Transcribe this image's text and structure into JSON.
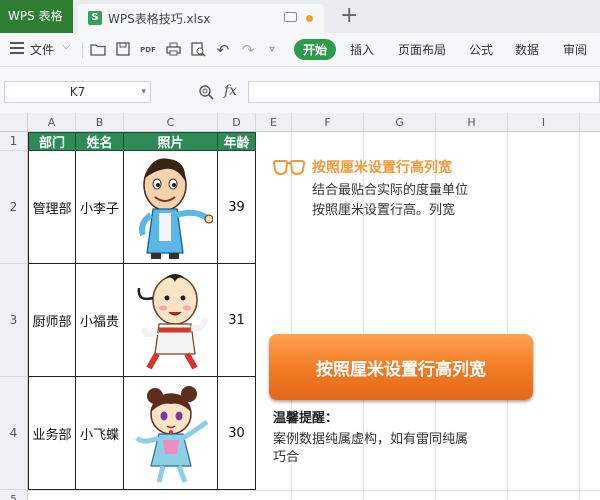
{
  "tabbar": {
    "app_tab": "WPS 表格",
    "doc_tab": "WPS表格技巧.xlsx",
    "new_tab": "+"
  },
  "ribbon": {
    "file_label": "文件",
    "tabs": [
      "开始",
      "插入",
      "页面布局",
      "公式",
      "数据",
      "审阅"
    ],
    "active_tab": "开始"
  },
  "formula_bar": {
    "name_box": "K7",
    "fx_label": "fx",
    "formula": ""
  },
  "grid": {
    "columns": [
      "A",
      "B",
      "C",
      "D",
      "E",
      "F",
      "G",
      "H",
      "I"
    ],
    "rows": [
      "1",
      "2",
      "3",
      "4",
      "5"
    ],
    "headers": [
      "部门",
      "姓名",
      "照片",
      "年龄"
    ],
    "records": [
      {
        "dept": "管理部",
        "name": "小李子",
        "photo": "cartoon-man",
        "age": "39"
      },
      {
        "dept": "厨师部",
        "name": "小福贵",
        "photo": "cartoon-boy",
        "age": "31"
      },
      {
        "dept": "业务部",
        "name": "小飞蝶",
        "photo": "cartoon-girl",
        "age": "30"
      }
    ]
  },
  "info_panel": {
    "icon": "glasses-icon",
    "title": "按照厘米设置行高列宽",
    "line1": "结合最贴合实际的度量单位",
    "line2": "按照厘米设置行高。列宽",
    "button_label": "按照厘米设置行高列宽",
    "tip_title": "温馨提醒：",
    "tip_line1": "案例数据纯属虚构，如有雷同纯属",
    "tip_line2": "巧合"
  },
  "colors": {
    "header_green": "#2e8b57",
    "accent_orange": "#f07a24",
    "app_green": "#2e7d32"
  }
}
